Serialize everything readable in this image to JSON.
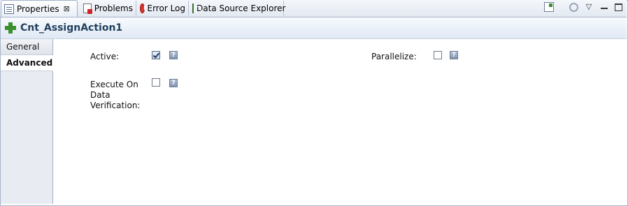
{
  "tabs": [
    {
      "label": "Properties",
      "icon": "properties-icon",
      "active": true
    },
    {
      "label": "Problems",
      "icon": "problems-icon",
      "active": false
    },
    {
      "label": "Error Log",
      "icon": "error-log-icon",
      "active": false
    },
    {
      "label": "Data Source Explorer",
      "icon": "data-source-explorer-icon",
      "active": false
    }
  ],
  "toolbar": {
    "close_glyph": "⊠",
    "menu_glyph": "▽"
  },
  "header": {
    "title": "Cnt_AssignAction1"
  },
  "sections": [
    {
      "label": "General",
      "selected": false
    },
    {
      "label": "Advanced",
      "selected": true
    }
  ],
  "form": {
    "active": {
      "label": "Active:",
      "checked": true,
      "help": "?"
    },
    "parallelize": {
      "label": "Parallelize:",
      "checked": false,
      "help": "?"
    },
    "execute_on_data_verification": {
      "label_line1": "Execute On",
      "label_line2": "Data",
      "label_line3": "Verification:",
      "checked": false,
      "help": "?"
    }
  },
  "colors": {
    "accent": "#22415f",
    "border": "#a7b4c8"
  }
}
